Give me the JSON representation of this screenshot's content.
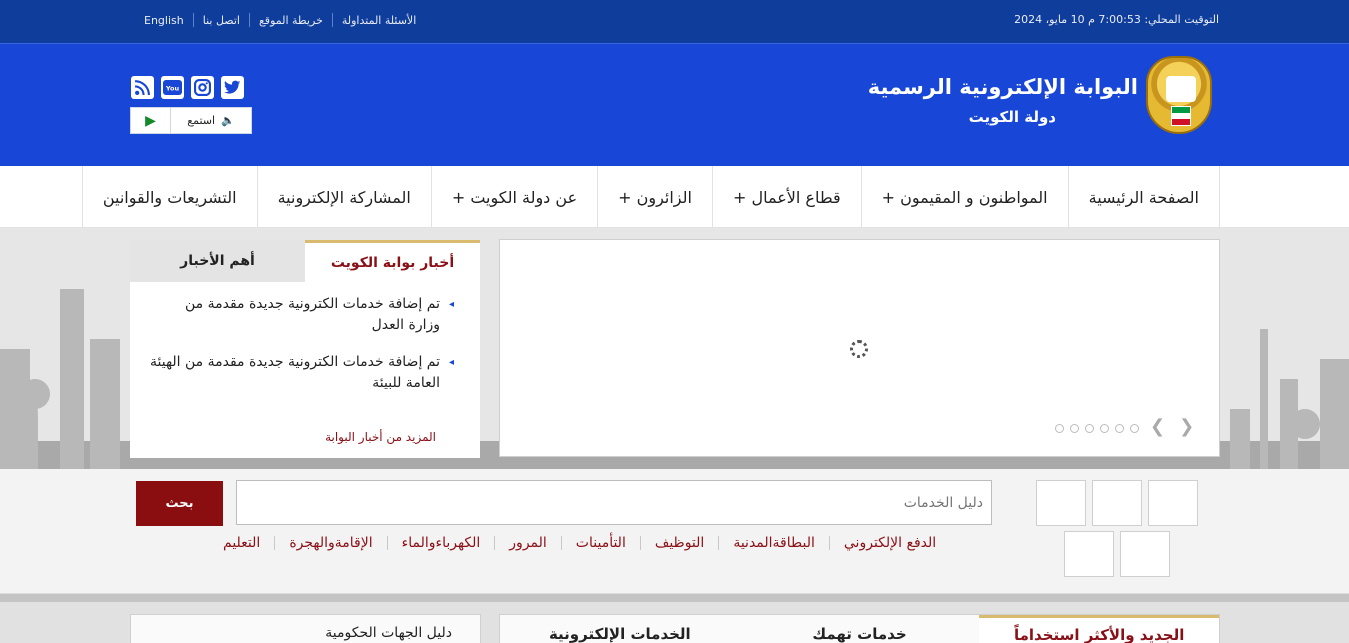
{
  "topbar": {
    "clock": "التوقيت المحلي: 7:00:53 م 10 مايو، 2024",
    "links": [
      "الأسئلة المتداولة",
      "خريطة الموقع",
      "اتصل بنا",
      "English"
    ]
  },
  "header": {
    "title": "البوابة الإلكترونية الرسمية",
    "subtitle": "دولة الكويت",
    "listen_label": "استمع",
    "social": [
      "rss-icon",
      "youtube-icon",
      "instagram-icon",
      "twitter-icon"
    ]
  },
  "nav": {
    "items": [
      "الصفحة الرئيسية",
      "المواطنون و المقيمون +",
      "قطاع الأعمال +",
      "الزائرون +",
      "عن دولة الكويت +",
      "المشاركة الإلكترونية",
      "التشريعات والقوانين"
    ]
  },
  "news": {
    "tab_active": "أخبار بوابة الكويت",
    "tab_inactive": "أهم الأخبار",
    "items": [
      "تم إضافة خدمات الكترونية جديدة مقدمة من وزارة العدل",
      "تم إضافة خدمات الكترونية جديدة مقدمة من الهيئة العامة للبيئة"
    ],
    "more": "المزيد من أخبار البوابة"
  },
  "search": {
    "placeholder": "دليل الخدمات",
    "button": "بحث",
    "quick_links": [
      "الدفع الإلكتروني",
      "البطاقةالمدنية",
      "التوظيف",
      "التأمينات",
      "المرور",
      "الكهرباءوالماء",
      "الإقامةوالهجرة",
      "التعليم"
    ]
  },
  "bottom": {
    "left_title": "دليل الجهات الحكومية",
    "tabs": [
      "الجديد والأكثر استخداماً",
      "خدمات تهمك",
      "الخدمات الإلكترونية"
    ]
  },
  "colors": {
    "top_bar": "#0f3d9c",
    "header": "#1846d6",
    "accent": "#8a1017",
    "gold": "#d8bb6e"
  }
}
